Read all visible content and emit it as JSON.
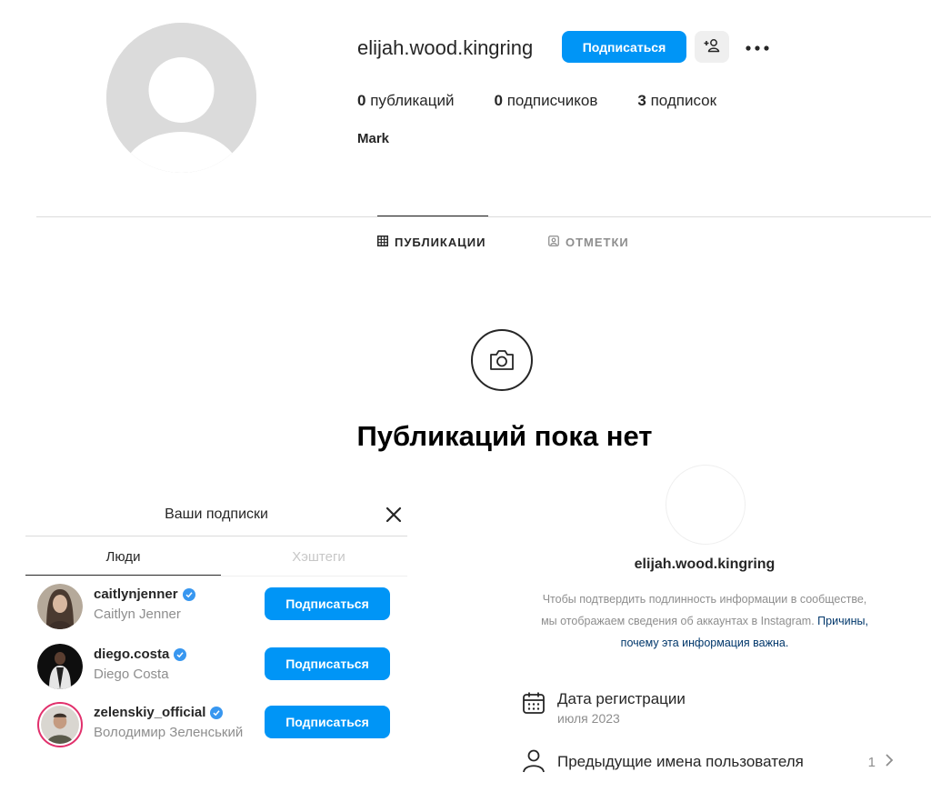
{
  "profile": {
    "username": "elijah.wood.kingring",
    "follow_label": "Подписаться",
    "posts_count": "0",
    "posts_label": "публикаций",
    "followers_count": "0",
    "followers_label": "подписчиков",
    "following_count": "3",
    "following_label": "подписок",
    "full_name": "Mark"
  },
  "tabs": {
    "posts": "ПУБЛИКАЦИИ",
    "tagged": "ОТМЕТКИ"
  },
  "empty_state": {
    "title": "Публикаций пока нет"
  },
  "following_panel": {
    "title": "Ваши подписки",
    "tab_people": "Люди",
    "tab_hashtags": "Хэштеги",
    "items": [
      {
        "username": "caitlynjenner",
        "name": "Caitlyn Jenner",
        "button": "Подписаться",
        "verified": true
      },
      {
        "username": "diego.costa",
        "name": "Diego Costa",
        "button": "Подписаться",
        "verified": true
      },
      {
        "username": "zelenskiy_official",
        "name": "Володимир Зеленський",
        "button": "Подписаться",
        "verified": true
      }
    ]
  },
  "about": {
    "username": "elijah.wood.kingring",
    "description": "Чтобы подтвердить подлинность информации в сообществе, мы отображаем сведения об аккаунтах в Instagram.",
    "link_text": "Причины, почему эта информация важна.",
    "date_label": "Дата регистрации",
    "date_value": "июля 2023",
    "prev_names_label": "Предыдущие имена пользователя",
    "prev_names_count": "1"
  },
  "colors": {
    "accent": "#0095f6",
    "verified": "#3897f0",
    "link": "#00376b",
    "muted": "#8e8e8e"
  },
  "icons": [
    "add-user-icon",
    "more-icon",
    "grid-icon",
    "tag-icon",
    "camera-icon",
    "close-icon",
    "verified-icon",
    "calendar-icon",
    "person-icon",
    "chevron-right-icon"
  ]
}
